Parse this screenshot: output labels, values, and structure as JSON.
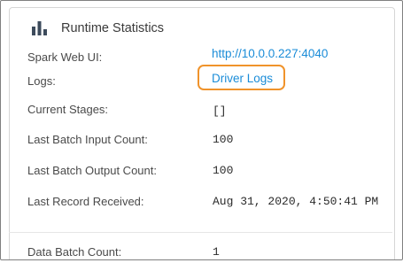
{
  "panel": {
    "title": "Runtime Statistics",
    "title_icon": "bar-chart-icon"
  },
  "rows": {
    "spark_web_ui": {
      "label": "Spark Web UI:",
      "value": "http://10.0.0.227:4040"
    },
    "logs": {
      "label": "Logs:",
      "value": "Driver Logs"
    },
    "current_stages": {
      "label": "Current Stages:",
      "value": "[]"
    },
    "last_batch_input_count": {
      "label": "Last Batch Input Count:",
      "value": "100"
    },
    "last_batch_output_count": {
      "label": "Last Batch Output Count:",
      "value": "100"
    },
    "last_record_received": {
      "label": "Last Record Received:",
      "value": "Aug 31, 2020, 4:50:41 PM"
    },
    "data_batch_count": {
      "label": "Data Batch Count:",
      "value": "1"
    }
  },
  "colors": {
    "link": "#1a8cd8",
    "highlight": "#f0932b",
    "border": "#d6d6d6"
  }
}
